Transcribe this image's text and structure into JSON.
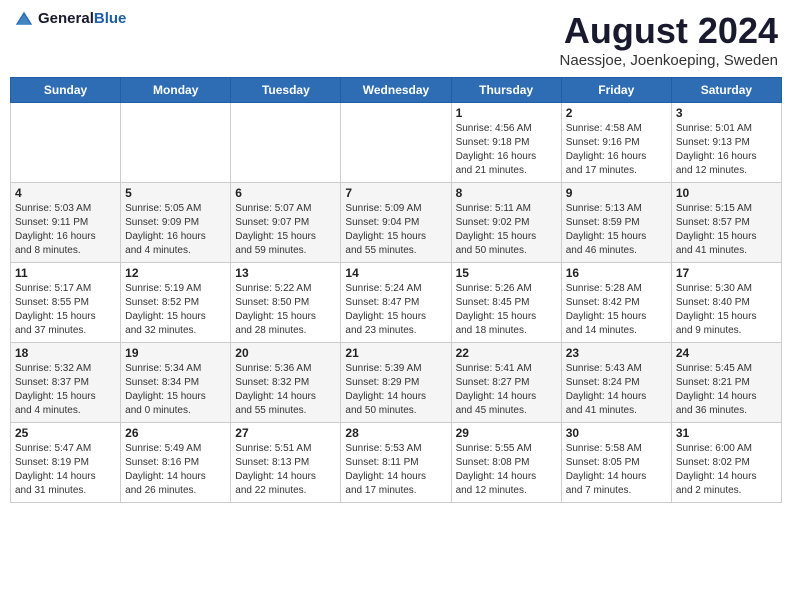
{
  "header": {
    "logo_general": "General",
    "logo_blue": "Blue",
    "title": "August 2024",
    "subtitle": "Naessjoe, Joenkoeping, Sweden"
  },
  "weekdays": [
    "Sunday",
    "Monday",
    "Tuesday",
    "Wednesday",
    "Thursday",
    "Friday",
    "Saturday"
  ],
  "weeks": [
    [
      {
        "day": "",
        "info": ""
      },
      {
        "day": "",
        "info": ""
      },
      {
        "day": "",
        "info": ""
      },
      {
        "day": "",
        "info": ""
      },
      {
        "day": "1",
        "info": "Sunrise: 4:56 AM\nSunset: 9:18 PM\nDaylight: 16 hours\nand 21 minutes."
      },
      {
        "day": "2",
        "info": "Sunrise: 4:58 AM\nSunset: 9:16 PM\nDaylight: 16 hours\nand 17 minutes."
      },
      {
        "day": "3",
        "info": "Sunrise: 5:01 AM\nSunset: 9:13 PM\nDaylight: 16 hours\nand 12 minutes."
      }
    ],
    [
      {
        "day": "4",
        "info": "Sunrise: 5:03 AM\nSunset: 9:11 PM\nDaylight: 16 hours\nand 8 minutes."
      },
      {
        "day": "5",
        "info": "Sunrise: 5:05 AM\nSunset: 9:09 PM\nDaylight: 16 hours\nand 4 minutes."
      },
      {
        "day": "6",
        "info": "Sunrise: 5:07 AM\nSunset: 9:07 PM\nDaylight: 15 hours\nand 59 minutes."
      },
      {
        "day": "7",
        "info": "Sunrise: 5:09 AM\nSunset: 9:04 PM\nDaylight: 15 hours\nand 55 minutes."
      },
      {
        "day": "8",
        "info": "Sunrise: 5:11 AM\nSunset: 9:02 PM\nDaylight: 15 hours\nand 50 minutes."
      },
      {
        "day": "9",
        "info": "Sunrise: 5:13 AM\nSunset: 8:59 PM\nDaylight: 15 hours\nand 46 minutes."
      },
      {
        "day": "10",
        "info": "Sunrise: 5:15 AM\nSunset: 8:57 PM\nDaylight: 15 hours\nand 41 minutes."
      }
    ],
    [
      {
        "day": "11",
        "info": "Sunrise: 5:17 AM\nSunset: 8:55 PM\nDaylight: 15 hours\nand 37 minutes."
      },
      {
        "day": "12",
        "info": "Sunrise: 5:19 AM\nSunset: 8:52 PM\nDaylight: 15 hours\nand 32 minutes."
      },
      {
        "day": "13",
        "info": "Sunrise: 5:22 AM\nSunset: 8:50 PM\nDaylight: 15 hours\nand 28 minutes."
      },
      {
        "day": "14",
        "info": "Sunrise: 5:24 AM\nSunset: 8:47 PM\nDaylight: 15 hours\nand 23 minutes."
      },
      {
        "day": "15",
        "info": "Sunrise: 5:26 AM\nSunset: 8:45 PM\nDaylight: 15 hours\nand 18 minutes."
      },
      {
        "day": "16",
        "info": "Sunrise: 5:28 AM\nSunset: 8:42 PM\nDaylight: 15 hours\nand 14 minutes."
      },
      {
        "day": "17",
        "info": "Sunrise: 5:30 AM\nSunset: 8:40 PM\nDaylight: 15 hours\nand 9 minutes."
      }
    ],
    [
      {
        "day": "18",
        "info": "Sunrise: 5:32 AM\nSunset: 8:37 PM\nDaylight: 15 hours\nand 4 minutes."
      },
      {
        "day": "19",
        "info": "Sunrise: 5:34 AM\nSunset: 8:34 PM\nDaylight: 15 hours\nand 0 minutes."
      },
      {
        "day": "20",
        "info": "Sunrise: 5:36 AM\nSunset: 8:32 PM\nDaylight: 14 hours\nand 55 minutes."
      },
      {
        "day": "21",
        "info": "Sunrise: 5:39 AM\nSunset: 8:29 PM\nDaylight: 14 hours\nand 50 minutes."
      },
      {
        "day": "22",
        "info": "Sunrise: 5:41 AM\nSunset: 8:27 PM\nDaylight: 14 hours\nand 45 minutes."
      },
      {
        "day": "23",
        "info": "Sunrise: 5:43 AM\nSunset: 8:24 PM\nDaylight: 14 hours\nand 41 minutes."
      },
      {
        "day": "24",
        "info": "Sunrise: 5:45 AM\nSunset: 8:21 PM\nDaylight: 14 hours\nand 36 minutes."
      }
    ],
    [
      {
        "day": "25",
        "info": "Sunrise: 5:47 AM\nSunset: 8:19 PM\nDaylight: 14 hours\nand 31 minutes."
      },
      {
        "day": "26",
        "info": "Sunrise: 5:49 AM\nSunset: 8:16 PM\nDaylight: 14 hours\nand 26 minutes."
      },
      {
        "day": "27",
        "info": "Sunrise: 5:51 AM\nSunset: 8:13 PM\nDaylight: 14 hours\nand 22 minutes."
      },
      {
        "day": "28",
        "info": "Sunrise: 5:53 AM\nSunset: 8:11 PM\nDaylight: 14 hours\nand 17 minutes."
      },
      {
        "day": "29",
        "info": "Sunrise: 5:55 AM\nSunset: 8:08 PM\nDaylight: 14 hours\nand 12 minutes."
      },
      {
        "day": "30",
        "info": "Sunrise: 5:58 AM\nSunset: 8:05 PM\nDaylight: 14 hours\nand 7 minutes."
      },
      {
        "day": "31",
        "info": "Sunrise: 6:00 AM\nSunset: 8:02 PM\nDaylight: 14 hours\nand 2 minutes."
      }
    ]
  ]
}
